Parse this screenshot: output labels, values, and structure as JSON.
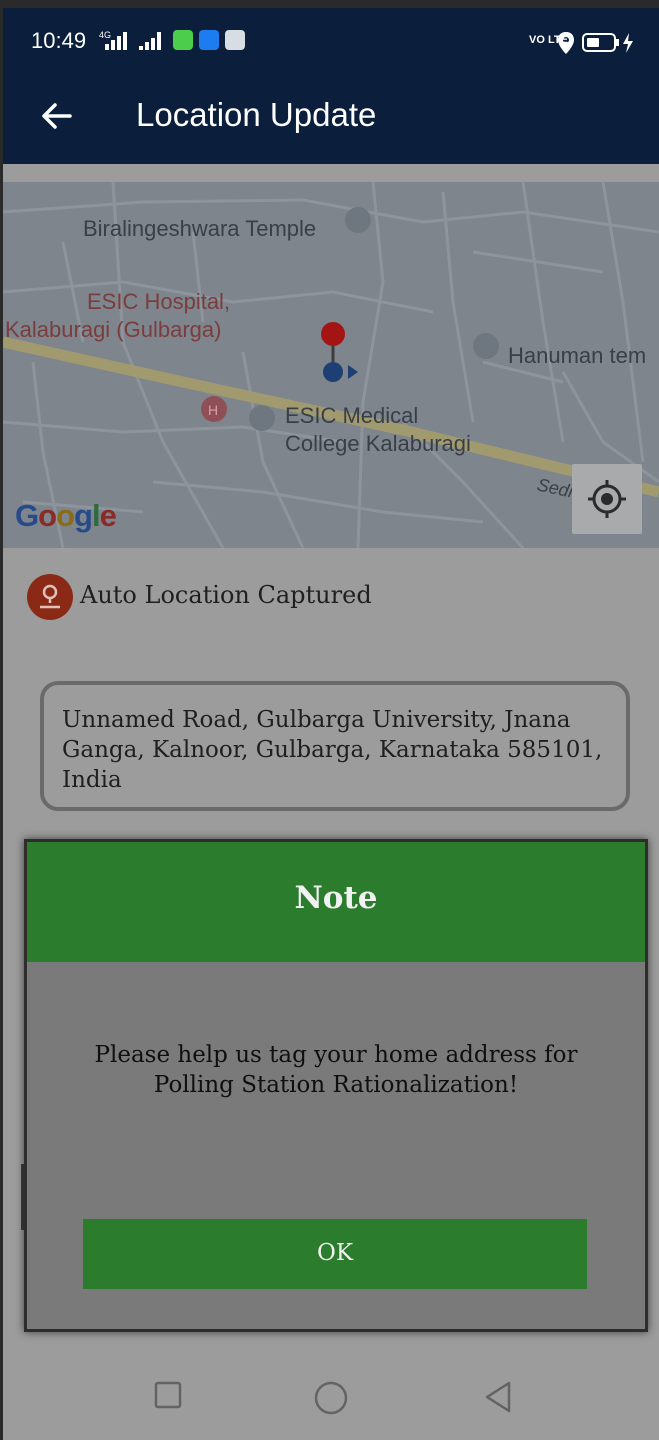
{
  "status_bar": {
    "time": "10:49",
    "network_label": "4G",
    "volte_label": "VO LTE",
    "icons": [
      "signal-icon",
      "signal-icon",
      "chat-app-icon",
      "shield-app-icon",
      "gallery-app-icon",
      "volte-icon",
      "location-icon",
      "battery-icon",
      "charging-icon"
    ]
  },
  "app_bar": {
    "title": "Location Update",
    "back_icon": "arrow-left-icon"
  },
  "map": {
    "labels": {
      "temple": "Biralingeshwara Temple",
      "hospital_line1": "ESIC Hospital,",
      "hospital_line2": "Kalaburagi (Gulbarga)",
      "hanuman": "Hanuman tem",
      "college_line1": "ESIC Medical",
      "college_line2": "College Kalaburagi",
      "road": "Sedi"
    },
    "brand": "Google",
    "my_location_icon": "crosshair-icon"
  },
  "capture": {
    "label": "Auto Location Captured",
    "icon": "location-person-icon"
  },
  "address": {
    "value": "Unnamed Road, Gulbarga University, Jnana Ganga, Kalnoor, Gulbarga, Karnataka 585101, India"
  },
  "dialog": {
    "title": "Note",
    "message": "Please help us tag your home address for Polling Station Rationalization!",
    "ok_label": "OK"
  },
  "nav_bar": {
    "icons": [
      "square-icon",
      "circle-icon",
      "triangle-back-icon"
    ]
  },
  "colors": {
    "app_bar": "#0b1f3c",
    "dialog_green": "#2b7c2d",
    "marker_red": "#d61f1f"
  }
}
